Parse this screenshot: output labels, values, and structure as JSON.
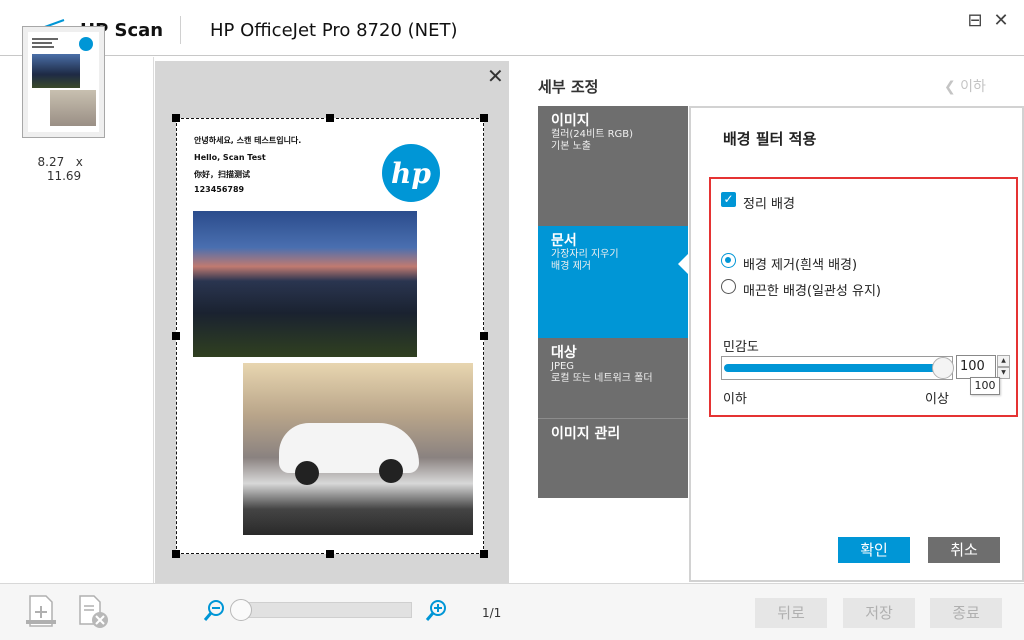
{
  "window": {
    "app_name": "HP Scan",
    "device_name": "HP OfficeJet Pro 8720 (NET)",
    "minimize": "⊟",
    "close": "✕"
  },
  "thumbnail": {
    "size_w": "8.27",
    "size_x": "x",
    "size_h": "11.69"
  },
  "preview": {
    "close": "✕",
    "page_lines": [
      "안녕하세요, 스캔 테스트입니다.",
      "Hello, Scan Test",
      "你好，扫描测试",
      "123456789"
    ]
  },
  "settings": {
    "title": "세부 조정",
    "back_label": "❮ 이하"
  },
  "tabs": [
    {
      "title": "이미지",
      "lines": [
        "컬러(24비트 RGB)",
        "기본 노출"
      ]
    },
    {
      "title": "문서",
      "lines": [
        "가장자리 지우기",
        "배경 제거"
      ]
    },
    {
      "title": "대상",
      "lines": [
        "JPEG",
        "로컬 또는 네트워크 폴더"
      ]
    },
    {
      "title": "이미지 관리",
      "lines": []
    }
  ],
  "detail": {
    "title": "배경 필터 적용",
    "checkbox_label": "정리 배경",
    "radio1_label": "배경 제거(흰색 배경)",
    "radio2_label": "매끈한 배경(일관성 유지)",
    "sensitivity_label": "민감도",
    "sensitivity_value": "100",
    "slider_fraction": 1.0,
    "tooltip": "100",
    "min_label": "이하",
    "max_label": "이상",
    "ok": "확인",
    "cancel": "취소"
  },
  "bottom": {
    "page_count": "1/1",
    "back": "뒤로",
    "save": "저장",
    "finish": "종료"
  },
  "colors": {
    "accent": "#0096d6",
    "tab_gray": "#6e6e6e",
    "highlight_red": "#e53333"
  }
}
